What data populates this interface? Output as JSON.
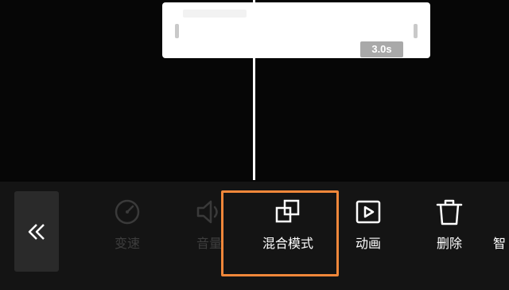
{
  "timeline": {
    "clip_duration": "3.0s"
  },
  "toolbar": {
    "tools": [
      {
        "label": "变速",
        "icon": "speed-gauge-icon",
        "state": "disabled"
      },
      {
        "label": "音量",
        "icon": "volume-icon",
        "state": "disabled"
      },
      {
        "label": "混合模式",
        "icon": "blend-mode-icon",
        "state": "highlighted"
      },
      {
        "label": "动画",
        "icon": "animation-icon",
        "state": "enabled"
      },
      {
        "label": "删除",
        "icon": "trash-icon",
        "state": "enabled"
      },
      {
        "label": "智",
        "icon": "",
        "state": "enabled"
      }
    ]
  },
  "colors": {
    "highlight": "#f0873a",
    "disabled_text": "#3e3e3e",
    "active_text": "#ffffff"
  }
}
